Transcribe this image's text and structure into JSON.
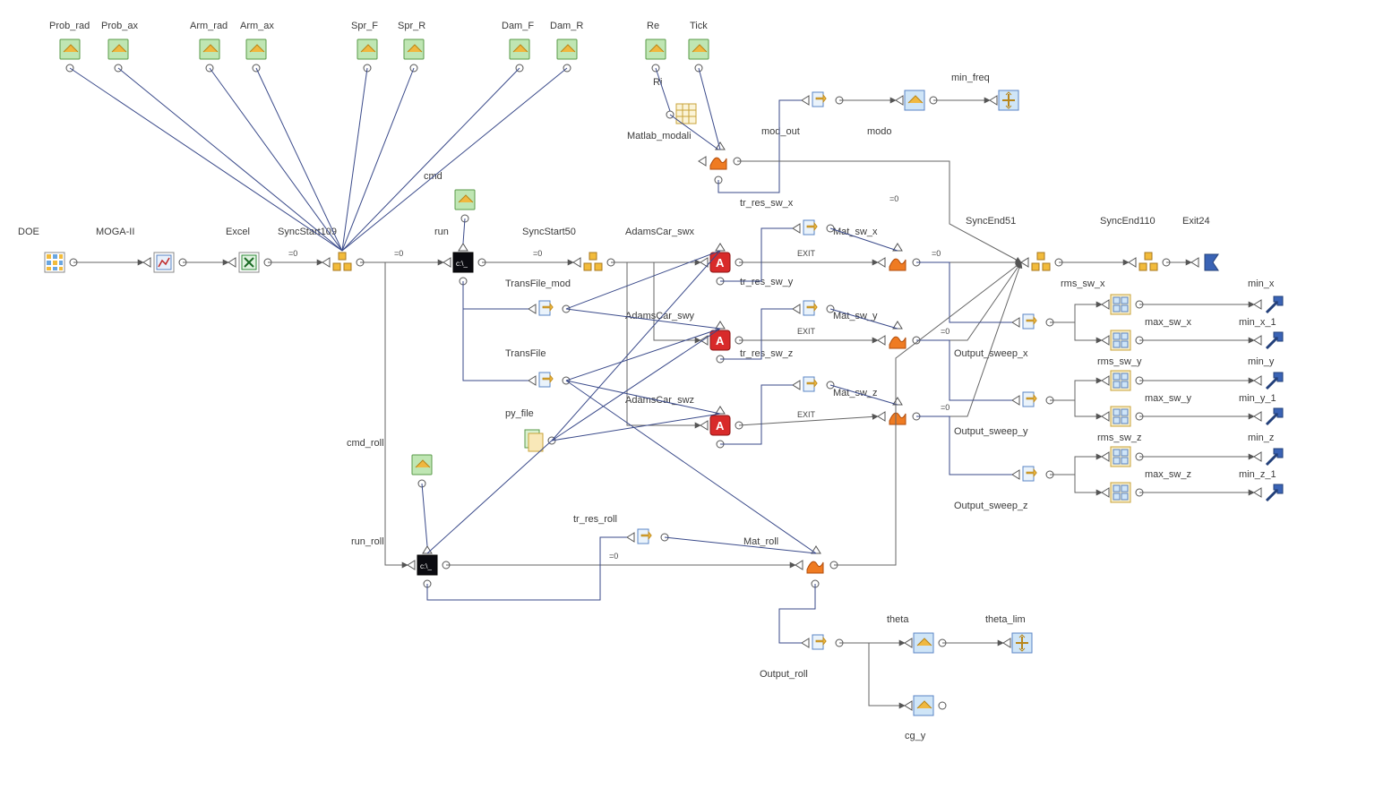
{
  "diagram": {
    "inputs": [
      {
        "name": "Prob_rad"
      },
      {
        "name": "Prob_ax"
      },
      {
        "name": "Arm_rad"
      },
      {
        "name": "Arm_ax"
      },
      {
        "name": "Spr_F"
      },
      {
        "name": "Spr_R"
      },
      {
        "name": "Dam_F"
      },
      {
        "name": "Dam_R"
      },
      {
        "name": "Re"
      },
      {
        "name": "Tick"
      }
    ],
    "nodes": {
      "doe": "DOE",
      "moga": "MOGA-II",
      "excel": "Excel",
      "sync109": "SyncStart109",
      "run": "run",
      "sync50": "SyncStart50",
      "cmd": "cmd",
      "matlab_modali": "Matlab_modali",
      "ri": "Ri",
      "transfile_mod": "TransFile_mod",
      "transfile": "TransFile",
      "py_file": "py_file",
      "cmd_roll": "cmd_roll",
      "run_roll": "run_roll",
      "adams_swx": "AdamsCar_swx",
      "adams_swy": "AdamsCar_swy",
      "adams_swz": "AdamsCar_swz",
      "tr_res_sw_x": "tr_res_sw_x",
      "tr_res_sw_y": "tr_res_sw_y",
      "tr_res_sw_z": "tr_res_sw_z",
      "mat_sw_x": "Mat_sw_x",
      "mat_sw_y": "Mat_sw_y",
      "mat_sw_z": "Mat_sw_z",
      "syncend51": "SyncEnd51",
      "syncend110": "SyncEnd110",
      "exit24": "Exit24",
      "output_sweep_x": "Output_sweep_x",
      "output_sweep_y": "Output_sweep_y",
      "output_sweep_z": "Output_sweep_z",
      "mod_out": "mod_out",
      "modo": "modo",
      "min_freq": "min_freq",
      "rms_sw_x": "rms_sw_x",
      "max_sw_x": "max_sw_x",
      "rms_sw_y": "rms_sw_y",
      "max_sw_y": "max_sw_y",
      "rms_sw_z": "rms_sw_z",
      "max_sw_z": "max_sw_z",
      "min_x": "min_x",
      "min_x_1": "min_x_1",
      "min_y": "min_y",
      "min_y_1": "min_y_1",
      "min_z": "min_z",
      "min_z_1": "min_z_1",
      "tr_res_roll": "tr_res_roll",
      "mat_roll": "Mat_roll",
      "output_roll": "Output_roll",
      "theta": "theta",
      "theta_lim": "theta_lim",
      "cg_y": "cg_y"
    },
    "edge_labels": {
      "eq0": "=0",
      "exit": "EXIT"
    }
  }
}
